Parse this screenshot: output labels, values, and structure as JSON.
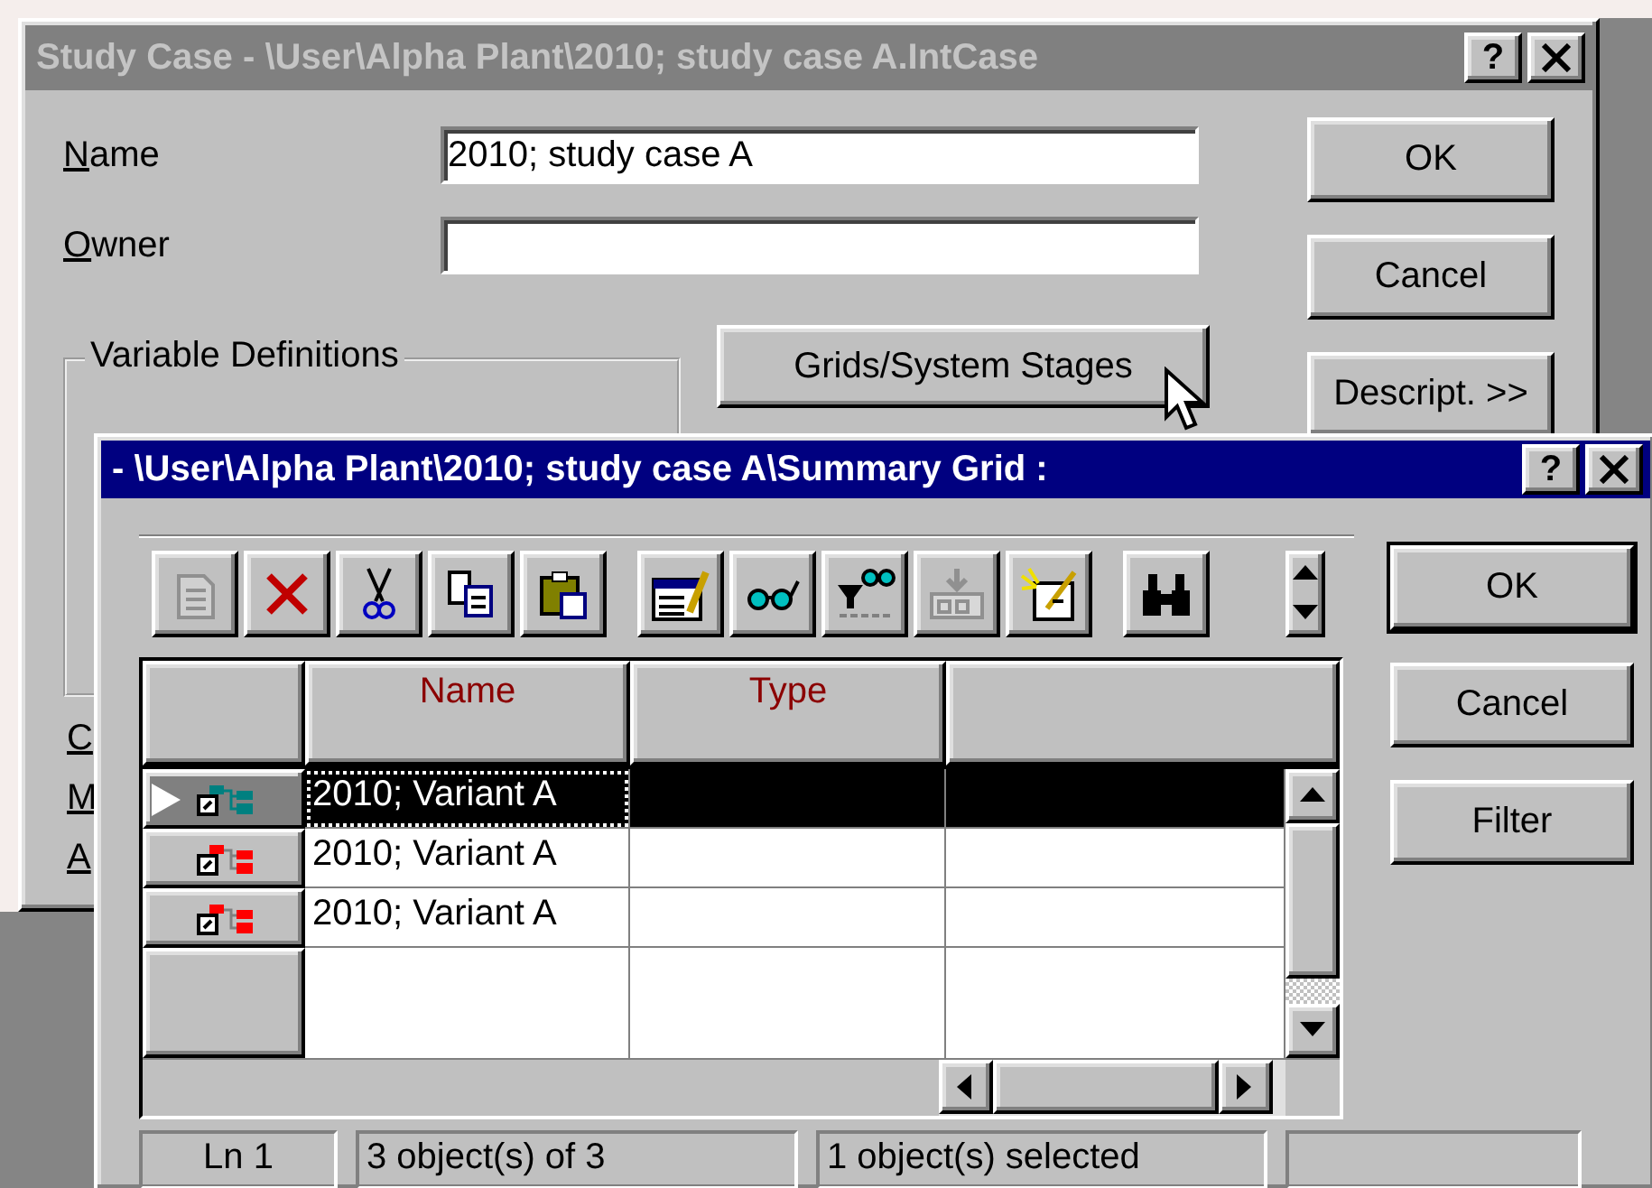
{
  "back_window": {
    "title": "Study Case - \\User\\Alpha Plant\\2010; study case A.IntCase",
    "active": false,
    "help": "?",
    "name_label": "Name",
    "name_value": "2010; study case A",
    "owner_label": "Owner",
    "group_title": "Variable Definitions",
    "grids_button": "Grids/System Stages",
    "side_labels": [
      "C",
      "M",
      "A"
    ],
    "buttons": [
      "OK",
      "Cancel",
      "Descript. >>"
    ]
  },
  "front_window": {
    "title": "- \\User\\Alpha Plant\\2010; study case A\\Summary Grid :",
    "active": true,
    "help": "?",
    "toolbar": [
      [
        {
          "disabled": true
        },
        {
          "disabled": false
        },
        {
          "disabled": false
        },
        {
          "disabled": false
        },
        {
          "disabled": false
        }
      ],
      [
        {
          "disabled": false
        },
        {
          "disabled": false
        },
        {
          "disabled": false
        },
        {
          "disabled": true
        },
        {
          "disabled": false
        }
      ],
      [
        {
          "disabled": false
        }
      ]
    ],
    "columns": [
      "Name",
      "Type"
    ],
    "rows": [
      {
        "name": "2010; Variant A",
        "selected": true
      },
      {
        "name": "2010; Variant A",
        "selected": false
      },
      {
        "name": "2010; Variant A",
        "selected": false
      }
    ],
    "buttons": [
      "OK",
      "Cancel",
      "Filter"
    ],
    "status_bar": [
      "Ln 1",
      "3 object(s) of 3",
      "1 object(s) selected"
    ]
  }
}
